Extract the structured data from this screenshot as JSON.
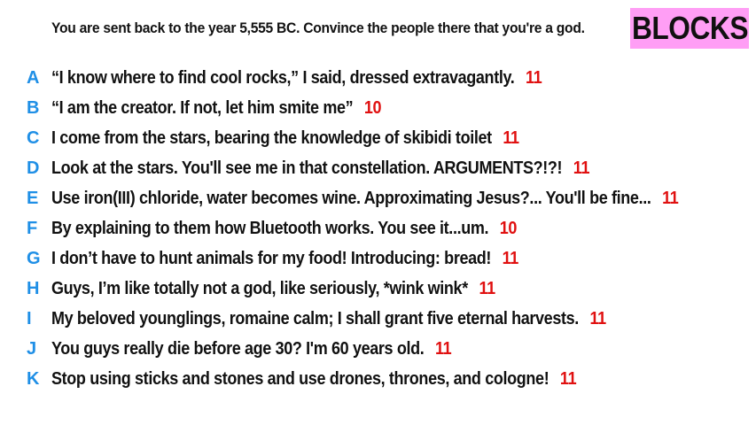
{
  "prompt": "You are sent back to the year 5,555 BC. Convince the people there that you're a god.",
  "badge": {
    "label": "BLOCKS",
    "color": "#ff9ef5"
  },
  "colors": {
    "letter": "#1f8fe6",
    "score": "#e01010",
    "text": "#111111"
  },
  "answers": [
    {
      "letter": "A",
      "text": "“I know where to find cool rocks,” I said, dressed extravagantly.",
      "score": "11"
    },
    {
      "letter": "B",
      "text": "“I am the creator. If not, let him smite me”",
      "score": "10"
    },
    {
      "letter": "C",
      "text": "I come from the stars, bearing the knowledge of skibidi toilet",
      "score": "11"
    },
    {
      "letter": "D",
      "text": "Look at the stars. You'll see me in that constellation. ARGUMENTS?!?!",
      "score": "11"
    },
    {
      "letter": "E",
      "text": "Use iron(III) chloride, water becomes wine. Approximating Jesus?... You'll be fine...",
      "score": "11"
    },
    {
      "letter": "F",
      "text": "By explaining to them how Bluetooth works. You see it...um.",
      "score": "10"
    },
    {
      "letter": "G",
      "text": "I don’t have to hunt animals for my food! Introducing: bread!",
      "score": "11"
    },
    {
      "letter": "H",
      "text": "Guys, I’m like totally not a god, like seriously, *wink wink*",
      "score": "11"
    },
    {
      "letter": "I",
      "text": "My beloved younglings, romaine calm; I shall grant five eternal harvests.",
      "score": "11"
    },
    {
      "letter": "J",
      "text": "You guys really die before age 30? I'm 60 years old.",
      "score": "11"
    },
    {
      "letter": "K",
      "text": "Stop using sticks and stones and use drones, thrones, and cologne!",
      "score": "11"
    }
  ]
}
